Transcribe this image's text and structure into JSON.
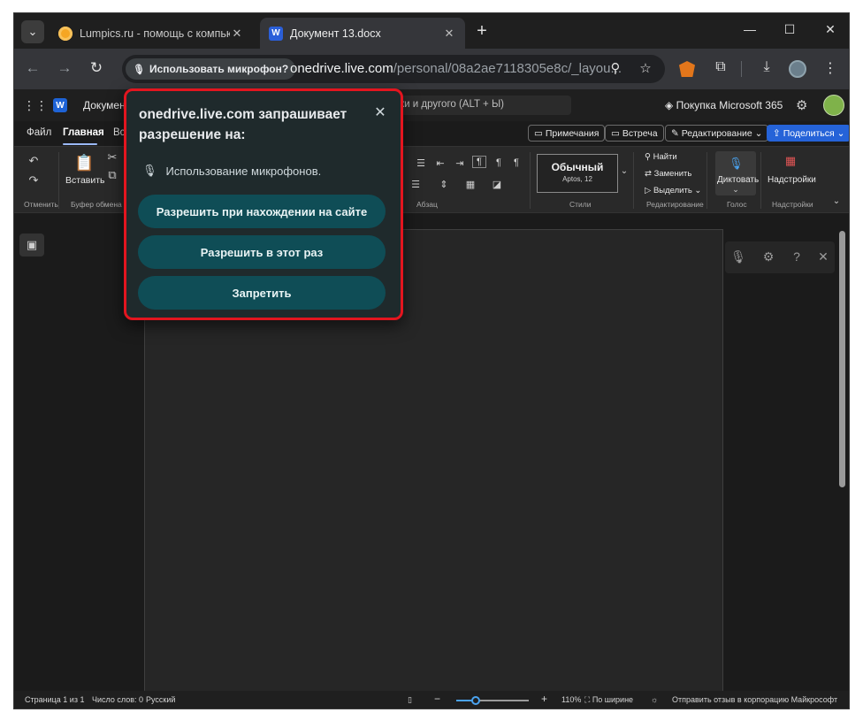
{
  "browser": {
    "tabs": [
      {
        "title": "Lumpics.ru - помощь с компью",
        "favicon": "orange-circle-icon"
      },
      {
        "title": "Документ 13.docx",
        "favicon": "word-icon"
      }
    ],
    "address": {
      "mic_chip": "Использовать микрофон?",
      "host": "onedrive.live.com",
      "path": "/personal/08a2ae7118305e8c/_layou..."
    },
    "icons": {
      "back": "←",
      "forward": "→",
      "reload": "↻",
      "zoom": "⚲",
      "star": "☆",
      "extensions": "⧉",
      "download": "⤓",
      "menu": "⋮",
      "tab_search": "⌄",
      "new_tab": "+",
      "minimize": "—",
      "maximize": "☐",
      "close": "✕",
      "tab_close": "✕"
    }
  },
  "word": {
    "app_letter": "W",
    "doc_title": "Докумен",
    "search_placeholder": "вки и другого (ALT + Ы)",
    "buy365": "Покупка Microsoft 365",
    "menu": {
      "file": "Файл",
      "home": "Главная",
      "insert": "Вс"
    },
    "actions": {
      "comments": "Примечания",
      "meeting": "Встреча",
      "editing": "Редактирование",
      "share": "Поделиться"
    },
    "ribbon": {
      "undo_group": "Отменить",
      "paste": "Вставить",
      "clipboard_group": "Буфер обмена",
      "paragraph_group": "Абзац",
      "style_name": "Обычный",
      "style_font": "Aptos, 12",
      "styles_group": "Стили",
      "find": "Найти",
      "replace": "Заменить",
      "select": "Выделить",
      "editing_group": "Редактирование",
      "dictate": "Диктовать",
      "voice_group": "Голос",
      "addins": "Надстройки",
      "addins_group": "Надстройки"
    },
    "status": {
      "page": "Страница 1 из 1",
      "words": "Число слов: 0",
      "language": "Русский",
      "zoom": "110%",
      "zoom_fraction": 0.27,
      "fit": "По ширине",
      "feedback": "Отправить отзыв в корпорацию Майкрософт"
    }
  },
  "permission_popup": {
    "host": "onedrive.live.com",
    "title_rest": " запрашивает разрешение на:",
    "permission": "Использование микрофонов.",
    "allow_site": "Разрешить при нахождении на сайте",
    "allow_once": "Разрешить в этот раз",
    "deny": "Запретить",
    "highlight_color": "#e3151f"
  }
}
